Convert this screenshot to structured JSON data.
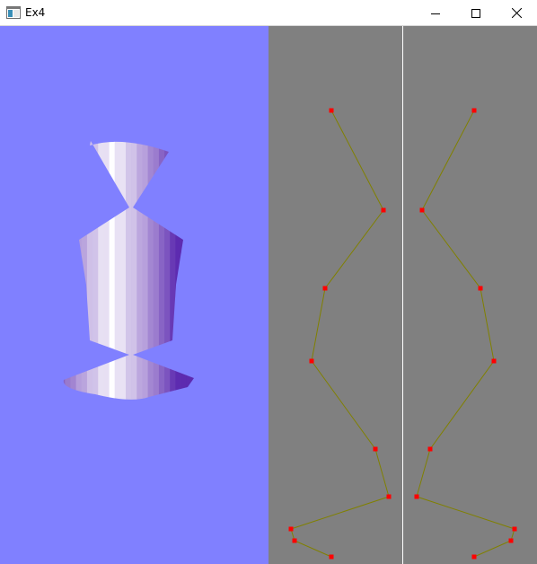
{
  "window": {
    "title": "Ex4",
    "icon": "app-window-icon",
    "controls": [
      "minimize-icon",
      "maximize-icon",
      "close-icon"
    ]
  },
  "viewport": {
    "background_color": "#8080ff",
    "object": "lathe-vase",
    "shade_dark": "#5d2bb0",
    "shade_light": "#ffffff"
  },
  "profile_editor": {
    "background_color": "#808080",
    "divider_color": "#ffffff",
    "line_color": "#808000",
    "point_color": "#ff0000",
    "control_point_count": 9
  }
}
